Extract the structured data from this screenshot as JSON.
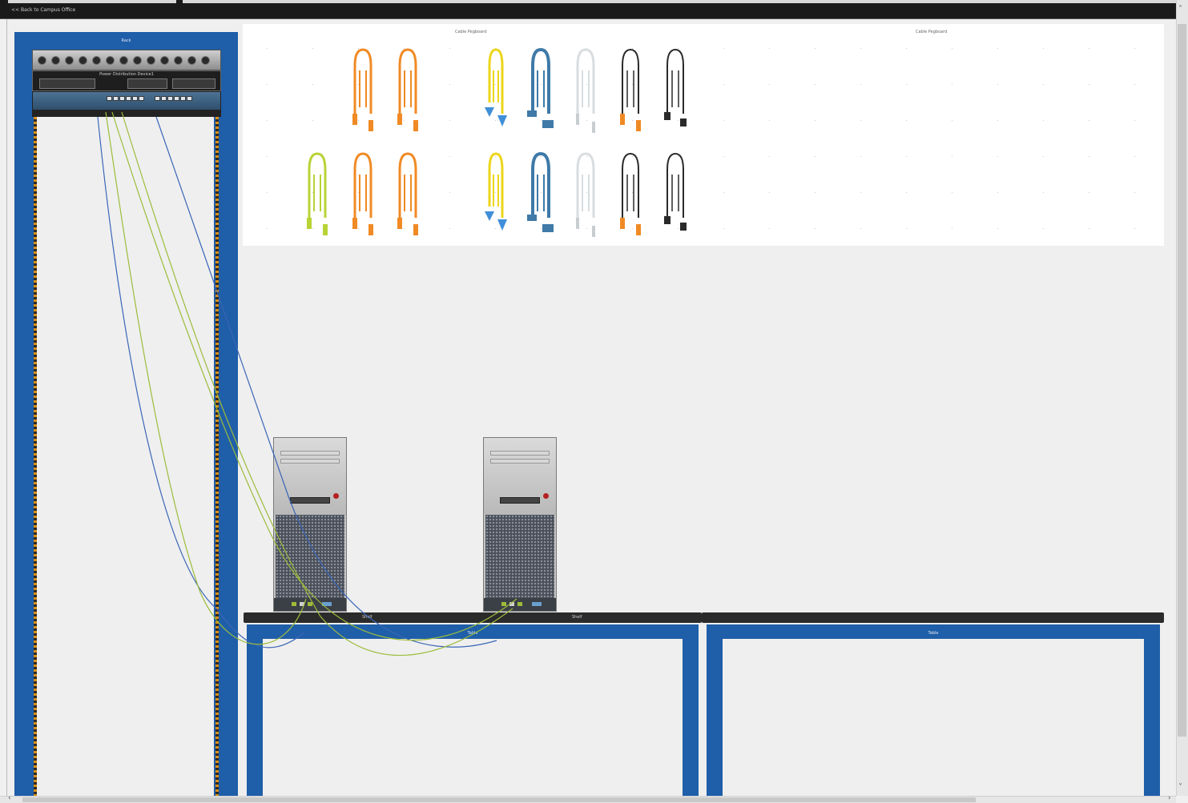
{
  "topbar": {
    "back_link": "<< Back to Campus Office"
  },
  "rack": {
    "title": "Rack",
    "pdu_label": "Power Distribution Device1"
  },
  "palette": {
    "left_title": "Cable Pegboard",
    "right_title": "Cable Pegboard"
  },
  "tables": [
    {
      "top_label_1": "Shelf",
      "top_label_2": "Shelf",
      "title": "Table"
    },
    {
      "title": "Table"
    }
  ],
  "colors": {
    "rack_blue": "#1f5ea8",
    "cable_orange": "#f08a24",
    "cable_yellow": "#ecd51a",
    "cable_lime": "#b7d336",
    "cable_steelblue": "#3f7aa8",
    "cable_white": "#d8dde0",
    "cable_black": "#2a2a2a",
    "wire_blue": "#3a66b7",
    "wire_green": "#9cbc3a"
  },
  "icons": {
    "scroll_up": "scroll-up-icon",
    "scroll_down": "scroll-down-icon",
    "scroll_left": "scroll-left-icon",
    "scroll_right": "scroll-right-icon"
  }
}
